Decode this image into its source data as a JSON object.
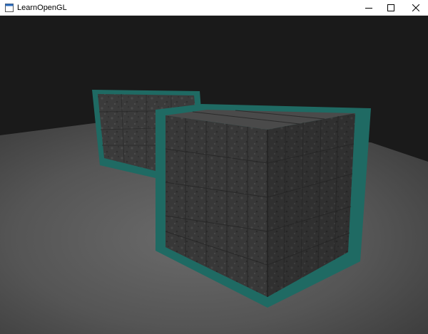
{
  "window": {
    "title": "LearnOpenGL",
    "icon": "app-icon",
    "controls": [
      {
        "name": "minimize",
        "icon": "minimize-icon"
      },
      {
        "name": "maximize",
        "icon": "maximize-icon"
      },
      {
        "name": "close",
        "icon": "close-icon"
      }
    ]
  },
  "scene": {
    "background_color": "#1a1a1a",
    "floor_color": "#5a5a5a",
    "cube_color": "#3d3d3d",
    "outline_color": "#1f6a63"
  }
}
